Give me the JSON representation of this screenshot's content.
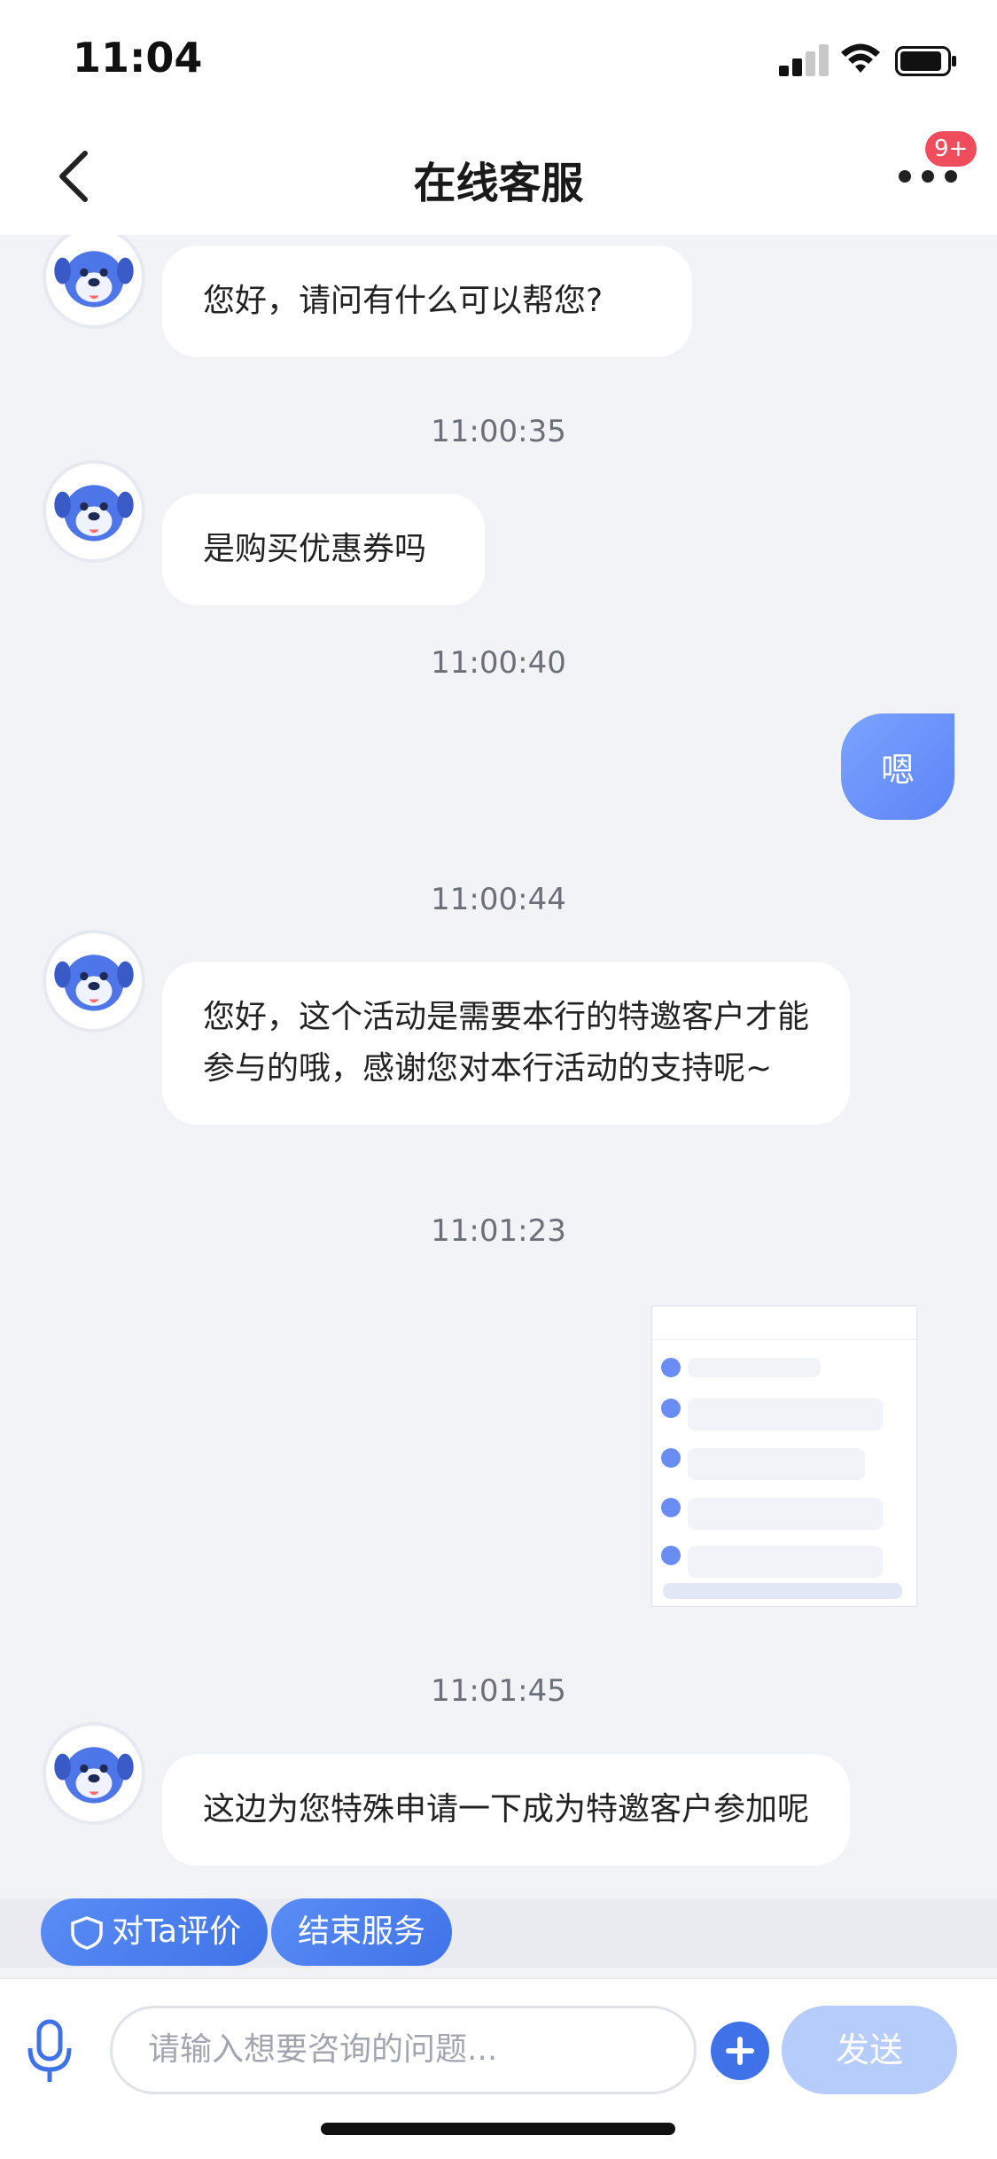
{
  "status_bar": {
    "time": "11:04"
  },
  "nav": {
    "title": "在线客服",
    "badge": "9+"
  },
  "messages": [
    {
      "from": "agent",
      "text": "您好，请问有什么可以帮您?"
    },
    {
      "timestamp": "11:00:35"
    },
    {
      "from": "agent",
      "text": "是购买优惠券吗"
    },
    {
      "timestamp": "11:00:40"
    },
    {
      "from": "user",
      "text": "嗯"
    },
    {
      "timestamp": "11:00:44"
    },
    {
      "from": "agent",
      "text": "您好，这个活动是需要本行的特邀客户才能参与的哦，感谢您对本行活动的支持呢~"
    },
    {
      "timestamp": "11:01:23"
    },
    {
      "from": "user",
      "type": "image"
    },
    {
      "timestamp": "11:01:45"
    },
    {
      "from": "agent",
      "text": "这边为您特殊申请一下成为特邀客户参加呢"
    }
  ],
  "quick_actions": {
    "rate": "对Ta评价",
    "end": "结束服务"
  },
  "input": {
    "placeholder": "请输入想要咨询的问题...",
    "send": "发送"
  },
  "colors": {
    "accent": "#3f72e8",
    "user_bubble": "#6a90f8",
    "badge": "#ef4d5b"
  }
}
